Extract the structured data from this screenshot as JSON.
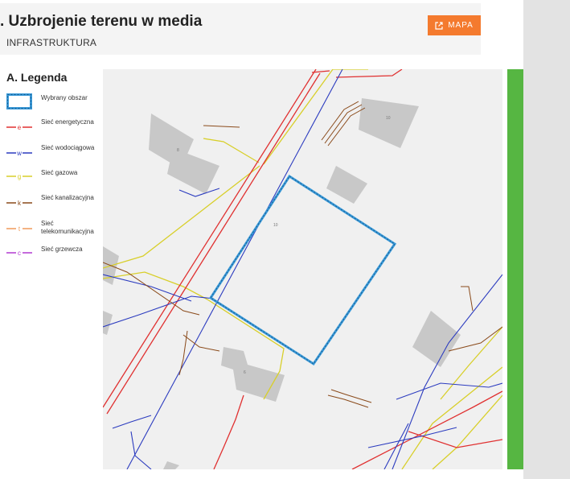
{
  "header": {
    "title": ". Uzbrojenie terenu w media",
    "subtitle": "INFRASTRUKTURA",
    "map_button_label": "MAPA"
  },
  "legend": {
    "title": "A. Legenda",
    "items": [
      {
        "label": "Wybrany obszar",
        "symbol": "",
        "color": "#3a9ad9"
      },
      {
        "label": "Sieć energetyczna",
        "symbol": "e",
        "color": "#e03030"
      },
      {
        "label": "Sieć wodociągowa",
        "symbol": "w",
        "color": "#2b3bbf"
      },
      {
        "label": "Sieć gazowa",
        "symbol": "g",
        "color": "#d8cf2a"
      },
      {
        "label": "Sieć kanalizacyjna",
        "symbol": "k",
        "color": "#8a4a1a"
      },
      {
        "label": "Sieć telekomunikacyjna",
        "symbol": "t",
        "color": "#f19a5a"
      },
      {
        "label": "Sieć grzewcza",
        "symbol": "c",
        "color": "#b23ad0"
      }
    ]
  },
  "map": {
    "parcel_label": "10",
    "building_labels": [
      "8",
      "10",
      "6"
    ],
    "colors": {
      "background": "#f0f0f0",
      "building": "#c8c8c8",
      "selected_area": "#3a9ad9",
      "side_bar": "#56b642"
    }
  }
}
